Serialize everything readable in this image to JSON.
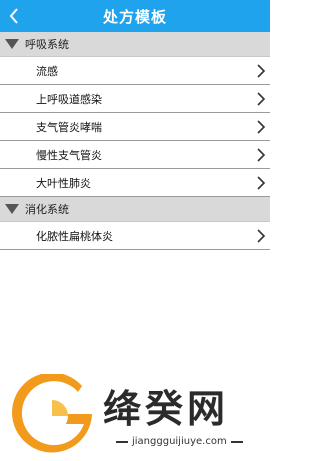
{
  "header": {
    "title": "处方模板"
  },
  "groups": [
    {
      "label": "呼吸系统",
      "items": [
        "流感",
        "上呼吸道感染",
        "支气管炎哮喘",
        "慢性支气管炎",
        "大叶性肺炎"
      ]
    },
    {
      "label": "消化系统",
      "items": [
        "化脓性扁桃体炎"
      ]
    }
  ],
  "watermark": {
    "brand": "绛癸网",
    "url": "jianggguijiuye.com"
  },
  "colors": {
    "titlebar": "#1fa3ec",
    "group_bg": "#d9d9d9",
    "logo_orange": "#f29a1c"
  }
}
